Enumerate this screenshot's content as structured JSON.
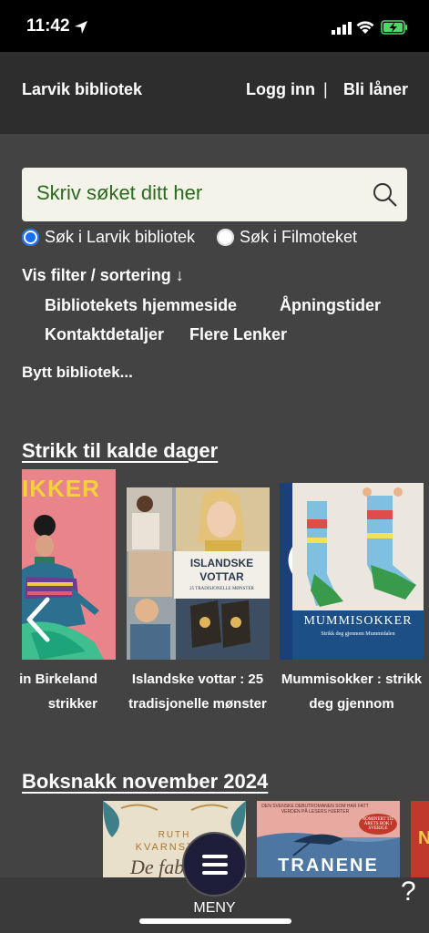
{
  "status": {
    "time": "11:42"
  },
  "nav": {
    "brand": "Larvik bibliotek",
    "login": "Logg inn",
    "separator": "|",
    "signup": "Bli låner"
  },
  "search": {
    "placeholder": "Skriv søket ditt her"
  },
  "scope": {
    "option1": "Søk i Larvik bibliotek",
    "option2": "Søk i Filmoteket",
    "selected": "option1"
  },
  "filter": {
    "label": "Vis filter / sortering ↓"
  },
  "links": [
    "Bibliotekets hjemmeside",
    "Åpningstider",
    "Kontaktdetaljer",
    "Flere Lenker"
  ],
  "switch_library": "Bytt bibliotek...",
  "section1": {
    "title": "Strikk til kalde dager",
    "books": [
      {
        "cover_title": "IKKER",
        "caption_l1": "in Birkeland",
        "caption_l2": "strikker"
      },
      {
        "cover_title": "ISLANDSKE VOTTAR",
        "cover_sub": "25 TRADISJONELLE MØNSTER",
        "caption_l1": "Islandske vottar : 25",
        "caption_l2": "tradisjonelle mønster"
      },
      {
        "cover_title": "MUMMISOKKER",
        "cover_sub": "Strikk deg gjennom Mummidalen",
        "caption_l1": "Mummisokker : strikk",
        "caption_l2": "deg gjennom"
      }
    ]
  },
  "section2": {
    "title": "Boksnakk november 2024",
    "books": [
      {
        "cover_author_1": "RUTH",
        "cover_author_2": "KVARNSTRÖ",
        "cover_title": "De fabe"
      },
      {
        "cover_top": "DEN SVENSKE DEBUTROMANEN SOM HAR FATT VERDEN PÅ LESERS HJERTER",
        "cover_badge": "NOMINERT TIL ÅRETS BOK I SVERIGE",
        "cover_title": "TRANENE"
      }
    ]
  },
  "menu": {
    "label": "MENY"
  },
  "help": {
    "label": "?"
  }
}
